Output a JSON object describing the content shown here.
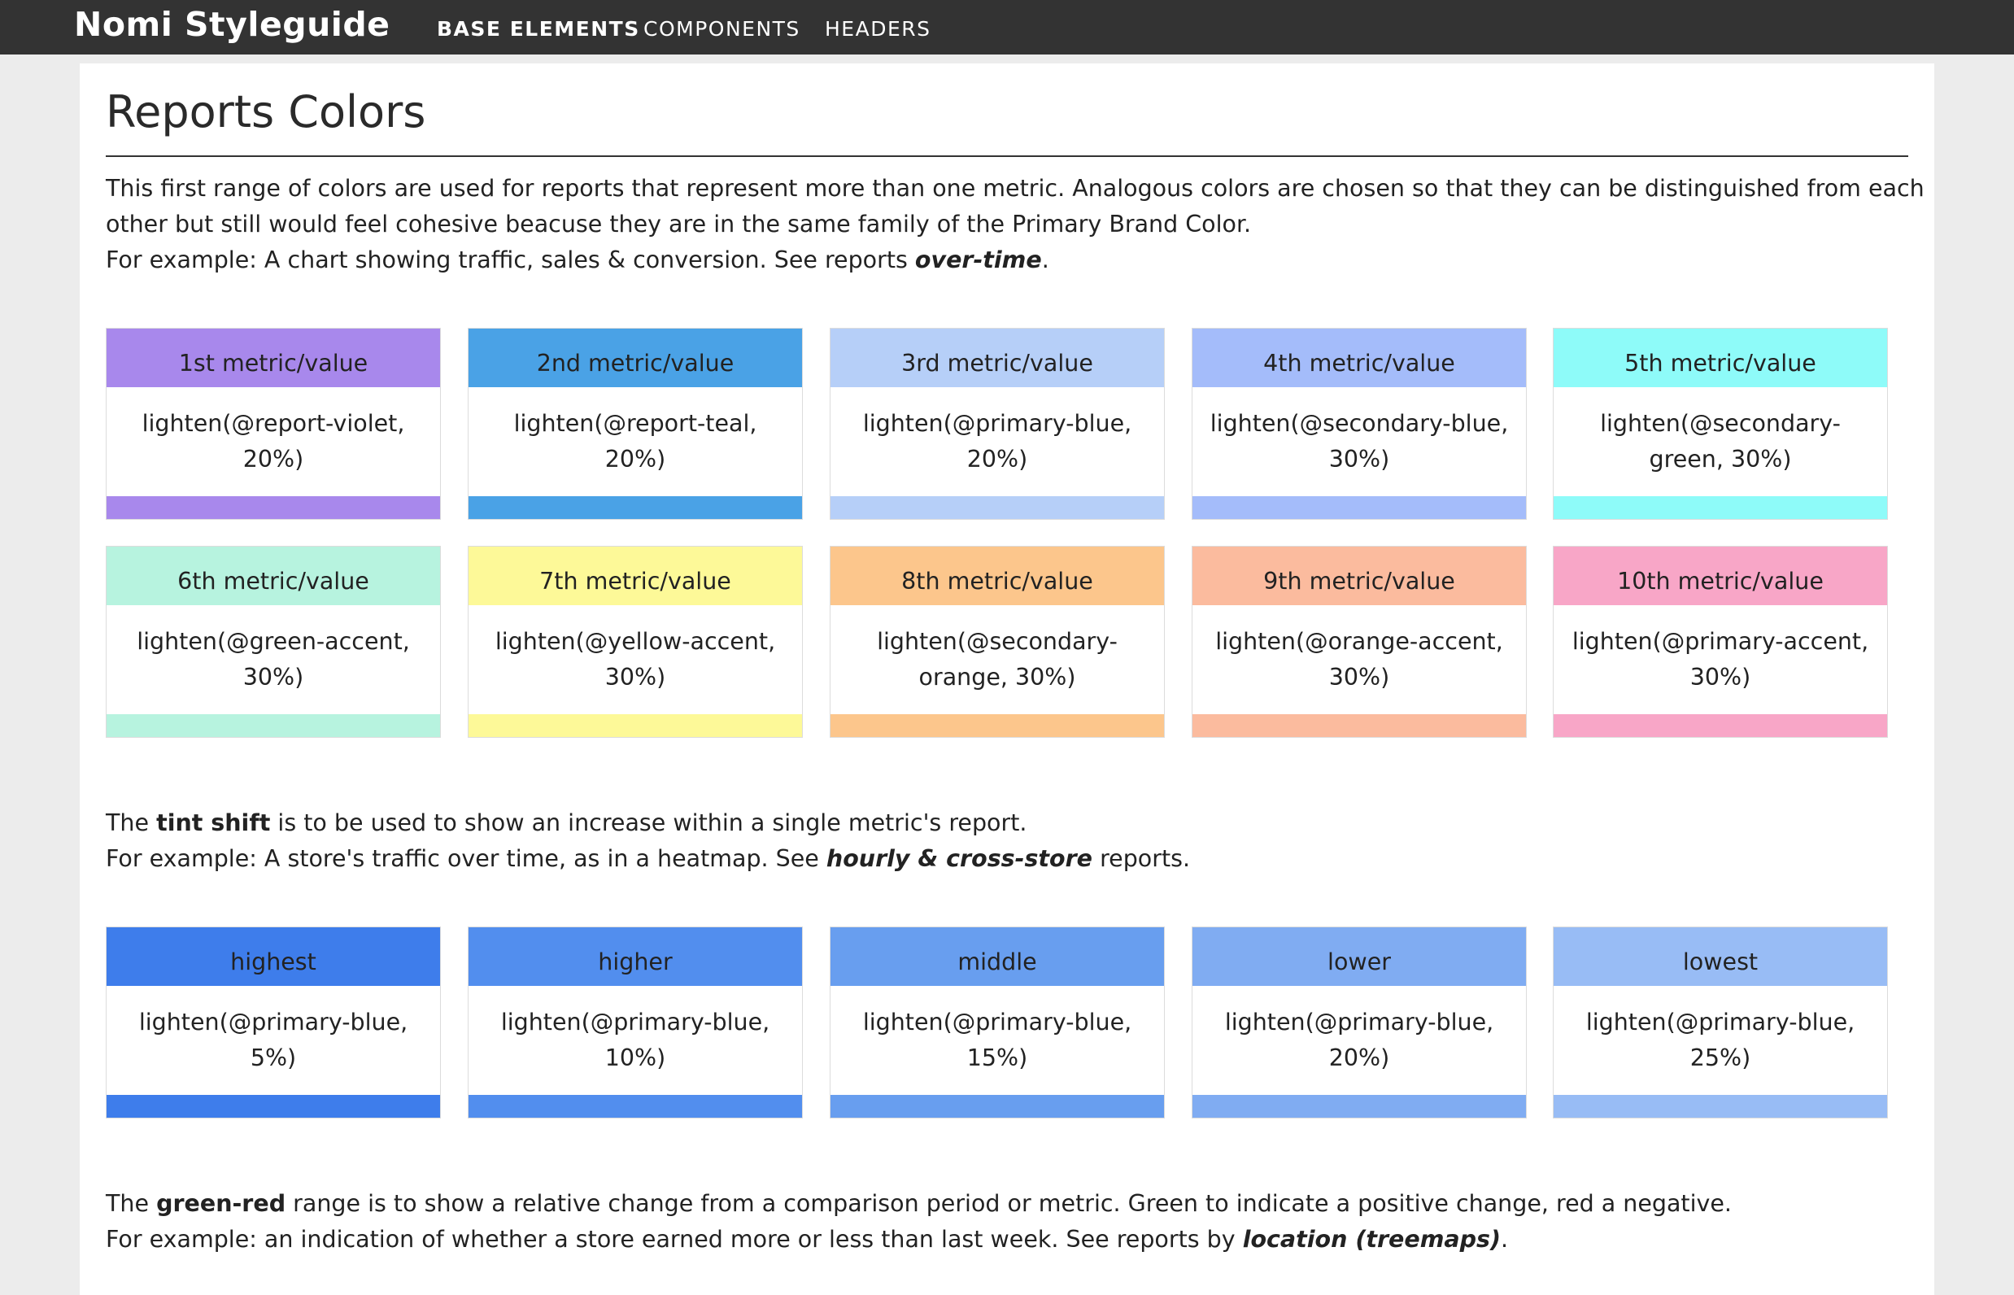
{
  "header": {
    "brand": "Nomi Styleguide",
    "nav": [
      {
        "label": "BASE ELEMENTS",
        "active": true
      },
      {
        "label": "COMPONENTS",
        "active": false
      },
      {
        "label": "HEADERS",
        "active": false
      }
    ]
  },
  "page": {
    "title": "Reports Colors",
    "intro": {
      "line1": "This first range of colors are used for reports that represent more than one metric. Analogous colors are chosen so that they can be distinguished from each",
      "line2": "other but still would feel cohesive beacuse they are in the same family of the Primary Brand Color.",
      "line3_prefix": "For example: A chart showing traffic, sales & conversion. See reports ",
      "line3_em": "over-time",
      "line3_suffix": "."
    },
    "metrics": [
      {
        "label": "1st metric/value",
        "formula": "lighten(@report-violet, 20%)",
        "color": "#a888ec"
      },
      {
        "label": "2nd metric/value",
        "formula": "lighten(@report-teal, 20%)",
        "color": "#4aa2e6"
      },
      {
        "label": "3rd metric/value",
        "formula": "lighten(@primary-blue, 20%)",
        "color": "#b6cff8"
      },
      {
        "label": "4th metric/value",
        "formula": "lighten(@secondary-blue, 30%)",
        "color": "#a4bcfa"
      },
      {
        "label": "5th metric/value",
        "formula": "lighten(@secondary-green, 30%)",
        "color": "#8efbf9"
      },
      {
        "label": "6th metric/value",
        "formula": "lighten(@green-accent, 30%)",
        "color": "#b7f3df"
      },
      {
        "label": "7th metric/value",
        "formula": "lighten(@yellow-accent, 30%)",
        "color": "#fdf998"
      },
      {
        "label": "8th metric/value",
        "formula": "lighten(@secondary-orange, 30%)",
        "color": "#fcc68c"
      },
      {
        "label": "9th metric/value",
        "formula": "lighten(@orange-accent, 30%)",
        "color": "#fbbb9e"
      },
      {
        "label": "10th metric/value",
        "formula": "lighten(@primary-accent, 30%)",
        "color": "#f8a6c7"
      }
    ],
    "tint": {
      "line1_prefix": "The ",
      "line1_strong": "tint shift",
      "line1_suffix": " is to be used to show an increase within a single metric's report.",
      "line2_prefix": "For example: A store's traffic over time, as in a heatmap. See ",
      "line2_em": "hourly & cross-store",
      "line2_suffix": " reports."
    },
    "tints": [
      {
        "label": "highest",
        "formula": "lighten(@primary-blue, 5%)",
        "color": "#3e7deb"
      },
      {
        "label": "higher",
        "formula": "lighten(@primary-blue, 10%)",
        "color": "#528eee"
      },
      {
        "label": "middle",
        "formula": "lighten(@primary-blue, 15%)",
        "color": "#689eef"
      },
      {
        "label": "lower",
        "formula": "lighten(@primary-blue, 20%)",
        "color": "#80acf2"
      },
      {
        "label": "lowest",
        "formula": "lighten(@primary-blue, 25%)",
        "color": "#98bcf5"
      }
    ],
    "greenred": {
      "line1_prefix": "The ",
      "line1_strong": "green-red",
      "line1_suffix": " range is to show a relative change from a comparison period or metric. Green to indicate a positive change, red a negative.",
      "line2_prefix": "For example: an indication of whether a store earned more or less than last week. See reports by ",
      "line2_em": "location (treemaps)",
      "line2_suffix": "."
    }
  }
}
